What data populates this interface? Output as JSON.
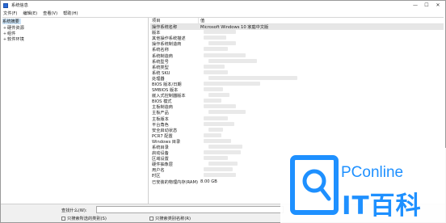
{
  "window": {
    "title": "系统信息",
    "controls": [
      "—",
      "☐",
      "✕"
    ]
  },
  "menu": [
    "文件(F)",
    "编辑(E)",
    "查看(V)",
    "帮助(H)"
  ],
  "tree": [
    {
      "label": "系统摘要",
      "toggle": "",
      "selected": true
    },
    {
      "label": "硬件资源",
      "toggle": "+",
      "selected": false
    },
    {
      "label": "组件",
      "toggle": "+",
      "selected": false
    },
    {
      "label": "软件环境",
      "toggle": "+",
      "selected": false
    }
  ],
  "table": {
    "headers": {
      "item": "项目",
      "value": "值"
    },
    "rows": [
      {
        "item": "操作系统名称",
        "value": "Microsoft Windows 10 家庭中文版"
      },
      {
        "item": "版本",
        "value": ""
      },
      {
        "item": "其他操作系统描述",
        "value": ""
      },
      {
        "item": "操作系统制造商",
        "value": ""
      },
      {
        "item": "系统名称",
        "value": ""
      },
      {
        "item": "系统制造商",
        "value": ""
      },
      {
        "item": "系统型号",
        "value": ""
      },
      {
        "item": "系统类型",
        "value": ""
      },
      {
        "item": "系统 SKU",
        "value": ""
      },
      {
        "item": "处理器",
        "value": ""
      },
      {
        "item": "BIOS 版本/日期",
        "value": ""
      },
      {
        "item": "SMBIOS 版本",
        "value": ""
      },
      {
        "item": "嵌入式控制器版本",
        "value": ""
      },
      {
        "item": "BIOS 模式",
        "value": ""
      },
      {
        "item": "主板制造商",
        "value": ""
      },
      {
        "item": "主板产品",
        "value": ""
      },
      {
        "item": "主板版本",
        "value": ""
      },
      {
        "item": "平台角色",
        "value": ""
      },
      {
        "item": "安全启动状态",
        "value": ""
      },
      {
        "item": "PCR7 配置",
        "value": ""
      },
      {
        "item": "Windows 目录",
        "value": ""
      },
      {
        "item": "系统目录",
        "value": ""
      },
      {
        "item": "启动设备",
        "value": ""
      },
      {
        "item": "区域设置",
        "value": ""
      },
      {
        "item": "硬件抽象层",
        "value": ""
      },
      {
        "item": "用户名",
        "value": ""
      },
      {
        "item": "时区",
        "value": ""
      },
      {
        "item": "已安装的物理内存(RAM)",
        "value": "8.00 GB"
      }
    ]
  },
  "find": {
    "label": "查找什么(W):",
    "value": "",
    "check_selected": "只搜索所选的类别(S)",
    "check_names": "只搜索类别名称(R)"
  },
  "watermark": {
    "brand": "PConline",
    "name": "IT百科"
  }
}
